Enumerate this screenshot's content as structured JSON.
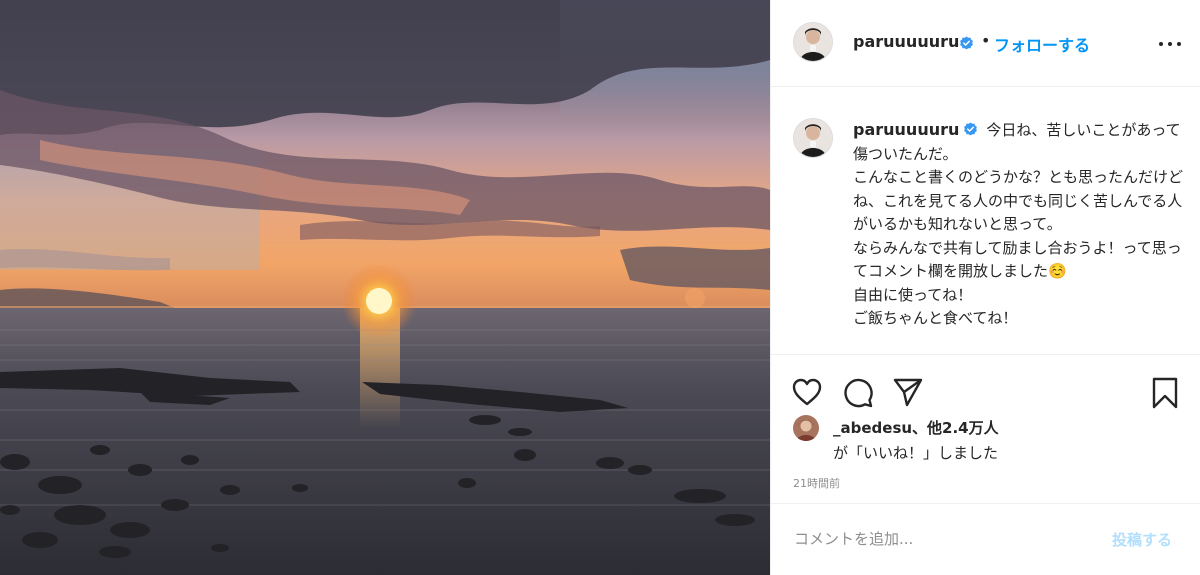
{
  "header": {
    "username": "paruuuuuru",
    "separator": "•",
    "follow_label": "フォローする",
    "verified_icon": "verified-badge-icon",
    "more_icon": "more-horizontal-icon"
  },
  "caption": {
    "username": "paruuuuuru",
    "lines": [
      "今日ね、苦しいことがあって傷ついたんだ。",
      "こんなこと書くのどうかな？とも思ったんだけどね、これを見てる人の中でも同じく苦しんでる人がいるかも知れないと思って。",
      "ならみんなで共有して励まし合おうよ！って思ってコメント欄を開放しました☺️",
      "自由に使ってね！",
      "ご飯ちゃんと食べてね！"
    ]
  },
  "actions": {
    "like_icon": "heart-icon",
    "comment_icon": "comment-icon",
    "share_icon": "paper-plane-icon",
    "save_icon": "bookmark-icon"
  },
  "likes": {
    "line1": "_abedesu、他2.4万人",
    "line2": "が「いいね！」しました"
  },
  "timestamp": "21時間前",
  "comment": {
    "placeholder": "コメントを追加...",
    "post_label": "投稿する"
  },
  "colors": {
    "link_blue": "#0095f6",
    "post_disabled": "#b2dffc",
    "verified_blue": "#3897f0",
    "border": "#efefef",
    "muted_text": "#8e8e8e"
  }
}
